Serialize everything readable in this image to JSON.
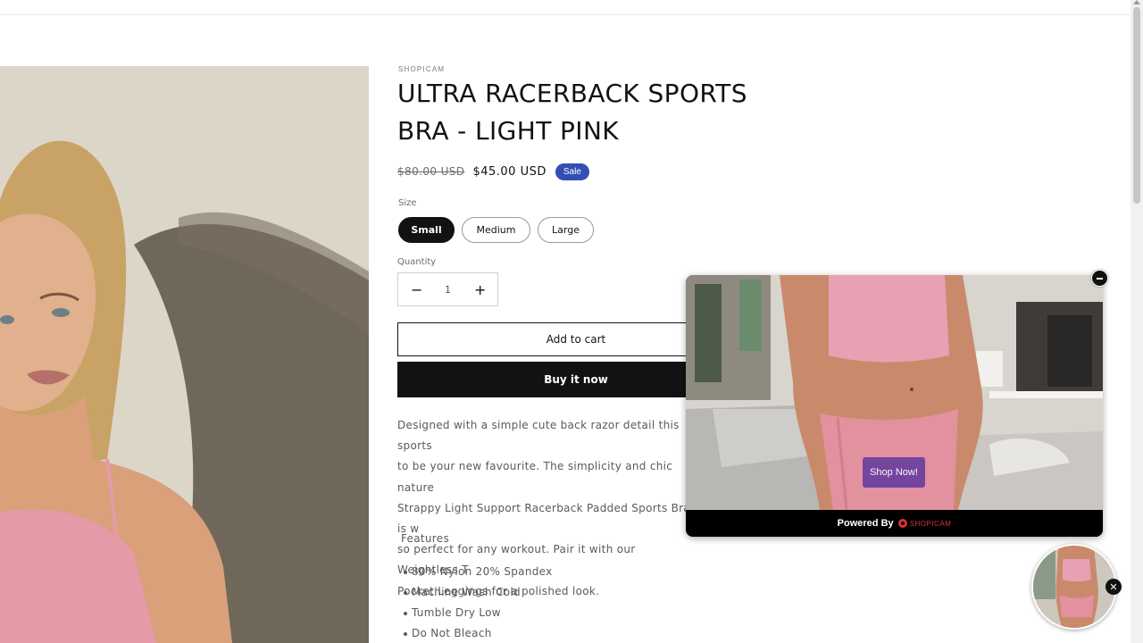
{
  "product": {
    "vendor": "SHOPICAM",
    "title": "ULTRA RACERBACK SPORTS BRA - LIGHT PINK",
    "price_old": "$80.00 USD",
    "price_new": "$45.00 USD",
    "sale_badge": "Sale",
    "size_label": "Size",
    "sizes": [
      "Small",
      "Medium",
      "Large"
    ],
    "selected_size": "Small",
    "quantity_label": "Quantity",
    "quantity_value": "1",
    "quantity_decrease": "−",
    "quantity_increase": "+",
    "add_to_cart": "Add to cart",
    "buy_now": "Buy it now",
    "description_lines": [
      "Designed with a simple cute back razor detail this sports",
      "to be your new favourite. The simplicity and chic nature",
      "Strappy Light Support Racerback Padded Sports Bra is w",
      "so perfect for any workout. Pair it with our Weightless T",
      "Pocket Leggings for a polished look."
    ],
    "features_title": "Features",
    "features": [
      "80%  Nylon 20% Spandex",
      "Machine Wash Cold",
      "Tumble Dry Low",
      "Do Not Bleach"
    ]
  },
  "video_widget": {
    "shop_now": "Shop Now!",
    "powered_by": "Powered By",
    "brand": "SHOPICAM",
    "bubble_close": "✕"
  },
  "icons": {
    "minimize": "minus-icon",
    "close": "close-icon",
    "brand_logo": "shopicam-logo-icon"
  },
  "colors": {
    "sale_badge": "#334fb4",
    "button_dark": "#121212",
    "shop_now": "#6a3fa0",
    "brand_red": "#e0303a"
  }
}
